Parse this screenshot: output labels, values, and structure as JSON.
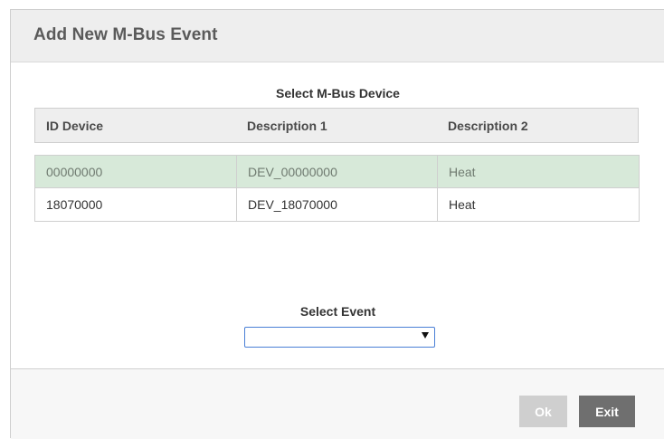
{
  "dialog": {
    "title": "Add New M-Bus Event"
  },
  "device_section": {
    "label": "Select M-Bus Device",
    "columns": [
      "ID Device",
      "Description 1",
      "Description 2"
    ],
    "rows": [
      {
        "id": "00000000",
        "desc1": "DEV_00000000",
        "desc2": "Heat",
        "selected": true
      },
      {
        "id": "18070000",
        "desc1": "DEV_18070000",
        "desc2": "Heat",
        "selected": false
      }
    ]
  },
  "event_section": {
    "label": "Select Event",
    "selected_value": ""
  },
  "footer": {
    "ok_label": "Ok",
    "exit_label": "Exit"
  },
  "colors": {
    "selected_row": "#d7e9d9",
    "ok_disabled": "#cfcfcf",
    "exit_button": "#6f6f6f",
    "select_border": "#4a7fd6"
  }
}
